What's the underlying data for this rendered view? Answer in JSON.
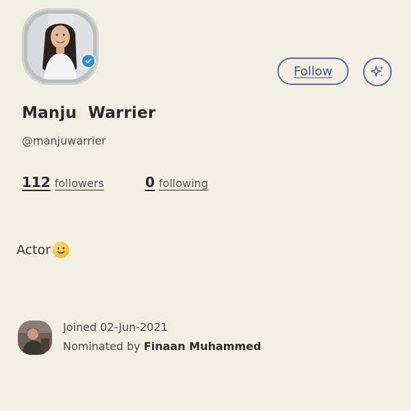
{
  "profile": {
    "display_name": "Manju  Warrier",
    "username": "@manjuwarrier",
    "verified": true,
    "followers_count": "112",
    "followers_label": "followers",
    "following_count": "0",
    "following_label": "following",
    "bio_text": "Actor",
    "bio_emoji": "slightly-smiling-face-icon"
  },
  "actions": {
    "follow_label": "Follow",
    "sparkle_icon": "sparkle-icon"
  },
  "joined": {
    "joined_text": "Joined 02-Jun-2021",
    "nominated_prefix": "Nominated by ",
    "nominator_name": "Finaan Muhammed"
  },
  "colors": {
    "background": "#f2efe5",
    "accent": "#5b6a99",
    "verified": "#2d8cdb"
  }
}
